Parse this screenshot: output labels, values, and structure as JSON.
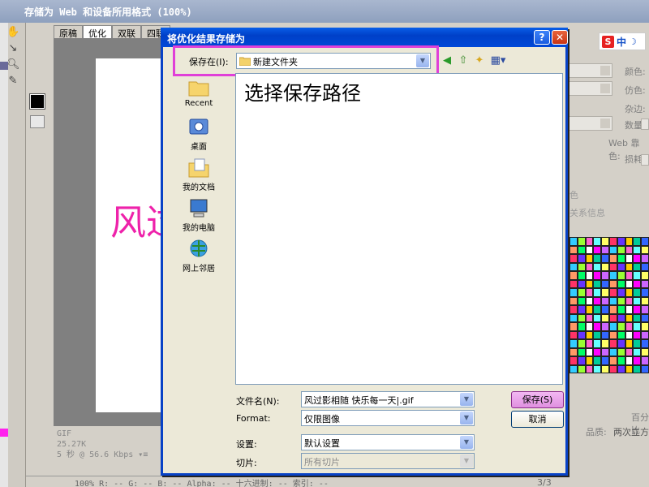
{
  "background_app": {
    "title": "存储为 Web 和设备所用格式 (100%)",
    "doc_tabs": [
      "原稿",
      "优化",
      "双联",
      "四联"
    ],
    "canvas_text": "风过",
    "info_lines": [
      "GIF",
      "25.27K",
      "5 秒 @ 56.6 Kbps  ▾≡"
    ],
    "status_bar": "100%    R: --    G: --    B: --    Alpha: --    十六进制: --    索引: --",
    "right_panel": {
      "labels": [
        "颜色:",
        "仿色:",
        "杂边:",
        "数量:",
        "Web 靠色:",
        "损耗:"
      ],
      "color_table_label": "色",
      "meta_label": "关系信息",
      "size_label": "百分比",
      "quality_label": "品质:",
      "quality_value": "两次立方",
      "page_indicator": "3/3"
    },
    "ime": {
      "logo": "S",
      "lang": "中"
    }
  },
  "dialog": {
    "title": "将优化结果存储为",
    "lookin_label": "保存在(I):",
    "lookin_value": "新建文件夹",
    "places": [
      {
        "label": "Recent",
        "icon": "recent-folder-icon"
      },
      {
        "label": "桌面",
        "icon": "desktop-icon"
      },
      {
        "label": "我的文档",
        "icon": "my-documents-icon"
      },
      {
        "label": "我的电脑",
        "icon": "my-computer-icon"
      },
      {
        "label": "网上邻居",
        "icon": "network-places-icon"
      }
    ],
    "file_list_hint": "选择保存路径",
    "filename_label": "文件名(N):",
    "filename_value": "风过影相随 快乐每一天|.gif",
    "format_label": "Format:",
    "format_value": "仅限图像",
    "settings_label": "设置:",
    "settings_value": "默认设置",
    "slices_label": "切片:",
    "slices_value": "所有切片",
    "save_button": "保存(S)",
    "cancel_button": "取消",
    "help_button": "?",
    "close_button": "✕"
  },
  "colors": {
    "highlight": "#e040d8",
    "title_bar": "#0040c8",
    "canvas_text": "#ee22aa"
  }
}
